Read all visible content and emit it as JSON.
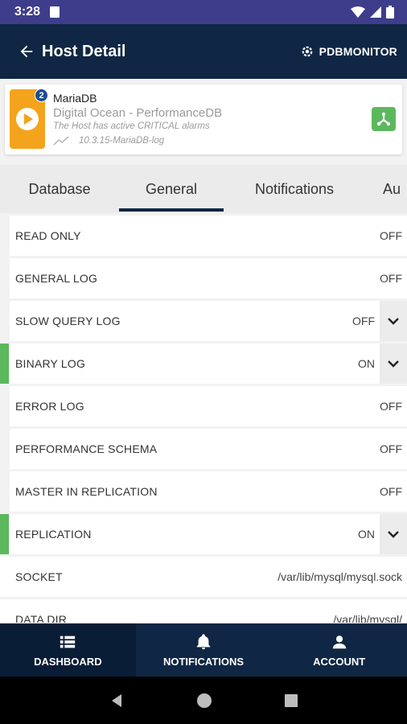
{
  "status_bar": {
    "time": "3:28"
  },
  "app_bar": {
    "title": "Host Detail",
    "brand": "PDBMONITOR"
  },
  "host": {
    "name": "MariaDB",
    "badge_count": "2",
    "subtitle": "Digital Ocean - PerformanceDB",
    "alarm_text": "The Host has active CRITICAL alarms",
    "version": "10.3.15-MariaDB-log",
    "accent_color": "#f4a31c"
  },
  "tabs": [
    {
      "label": "Database"
    },
    {
      "label": "General",
      "active": true
    },
    {
      "label": "Notifications"
    },
    {
      "label": "Au"
    }
  ],
  "rows": [
    {
      "label": "READ ONLY",
      "value": "OFF"
    },
    {
      "label": "GENERAL LOG",
      "value": "OFF"
    },
    {
      "label": "SLOW QUERY LOG",
      "value": "OFF",
      "expandable": true
    },
    {
      "label": "BINARY LOG",
      "value": "ON",
      "expandable": true,
      "status": "on"
    },
    {
      "label": "ERROR LOG",
      "value": "OFF"
    },
    {
      "label": "PERFORMANCE SCHEMA",
      "value": "OFF"
    },
    {
      "label": "MASTER IN REPLICATION",
      "value": "OFF"
    },
    {
      "label": "REPLICATION",
      "value": "ON",
      "expandable": true,
      "status": "on"
    },
    {
      "label": "SOCKET",
      "value": "/var/lib/mysql/mysql.sock"
    },
    {
      "label": "DATA DIR",
      "value": "/var/lib/mysql/"
    }
  ],
  "bottom_nav": [
    {
      "label": "DASHBOARD",
      "icon": "list-icon",
      "active": true
    },
    {
      "label": "NOTIFICATIONS",
      "icon": "bell-icon"
    },
    {
      "label": "ACCOUNT",
      "icon": "person-icon"
    }
  ],
  "colors": {
    "primary": "#0f2744",
    "status_bar": "#3d3d8c",
    "on_indicator": "#5cb85c"
  }
}
